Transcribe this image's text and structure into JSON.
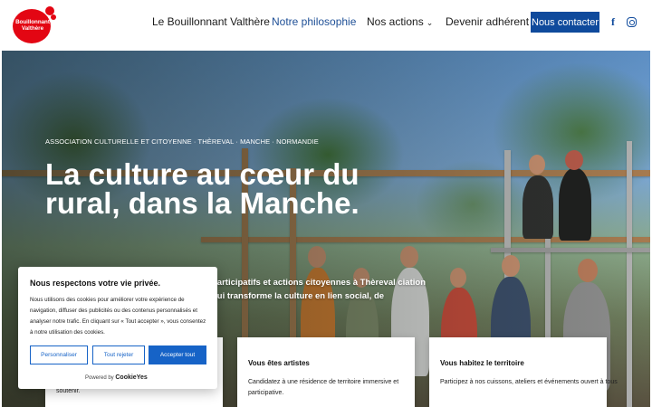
{
  "header": {
    "logo_text": "Bouillonnant Valthère",
    "nav": [
      {
        "label": "Le Bouillonnant Valthère"
      },
      {
        "label": "Notre philosophie"
      },
      {
        "label": "Nos actions"
      },
      {
        "label": "Devenir adhérent"
      }
    ],
    "contact_label": "Nous contacter",
    "accent": "#0f4a9c",
    "active_nav_color": "#1e4f96",
    "social": [
      "facebook-icon",
      "instagram-icon"
    ]
  },
  "hero": {
    "eyebrow": "ASSOCIATION CULTURELLE ET CITOYENNE · THÈREVAL · MANCHE · NORMANDIE",
    "title": "La culture au cœur du rural, dans la Manche.",
    "lead": "participatifs et actions citoyennes à Thèreval ciation qui transforme la culture en lien social, de"
  },
  "cards": [
    {
      "title": "",
      "text": "soutenir."
    },
    {
      "title": "Vous êtes artistes",
      "text": "Candidatez à une résidence de territoire immersive et participative."
    },
    {
      "title": "Vous habitez le territoire",
      "text": "Participez à nos cuissons, ateliers et événements ouvert à tous"
    }
  ],
  "cookie": {
    "title": "Nous respectons votre vie privée.",
    "body": "Nous utilisons des cookies pour améliorer votre expérience de navigation, diffuser des publicités ou des contenus personnalisés et analyser notre trafic. En cliquant sur « Tout accepter », vous consentez à notre utilisation des cookies.",
    "customize_label": "Personnaliser",
    "reject_label": "Tout rejeter",
    "accept_label": "Accepter tout",
    "powered_prefix": "Powered by",
    "powered_brand": "CookieYes",
    "button_color": "#1663c7"
  }
}
